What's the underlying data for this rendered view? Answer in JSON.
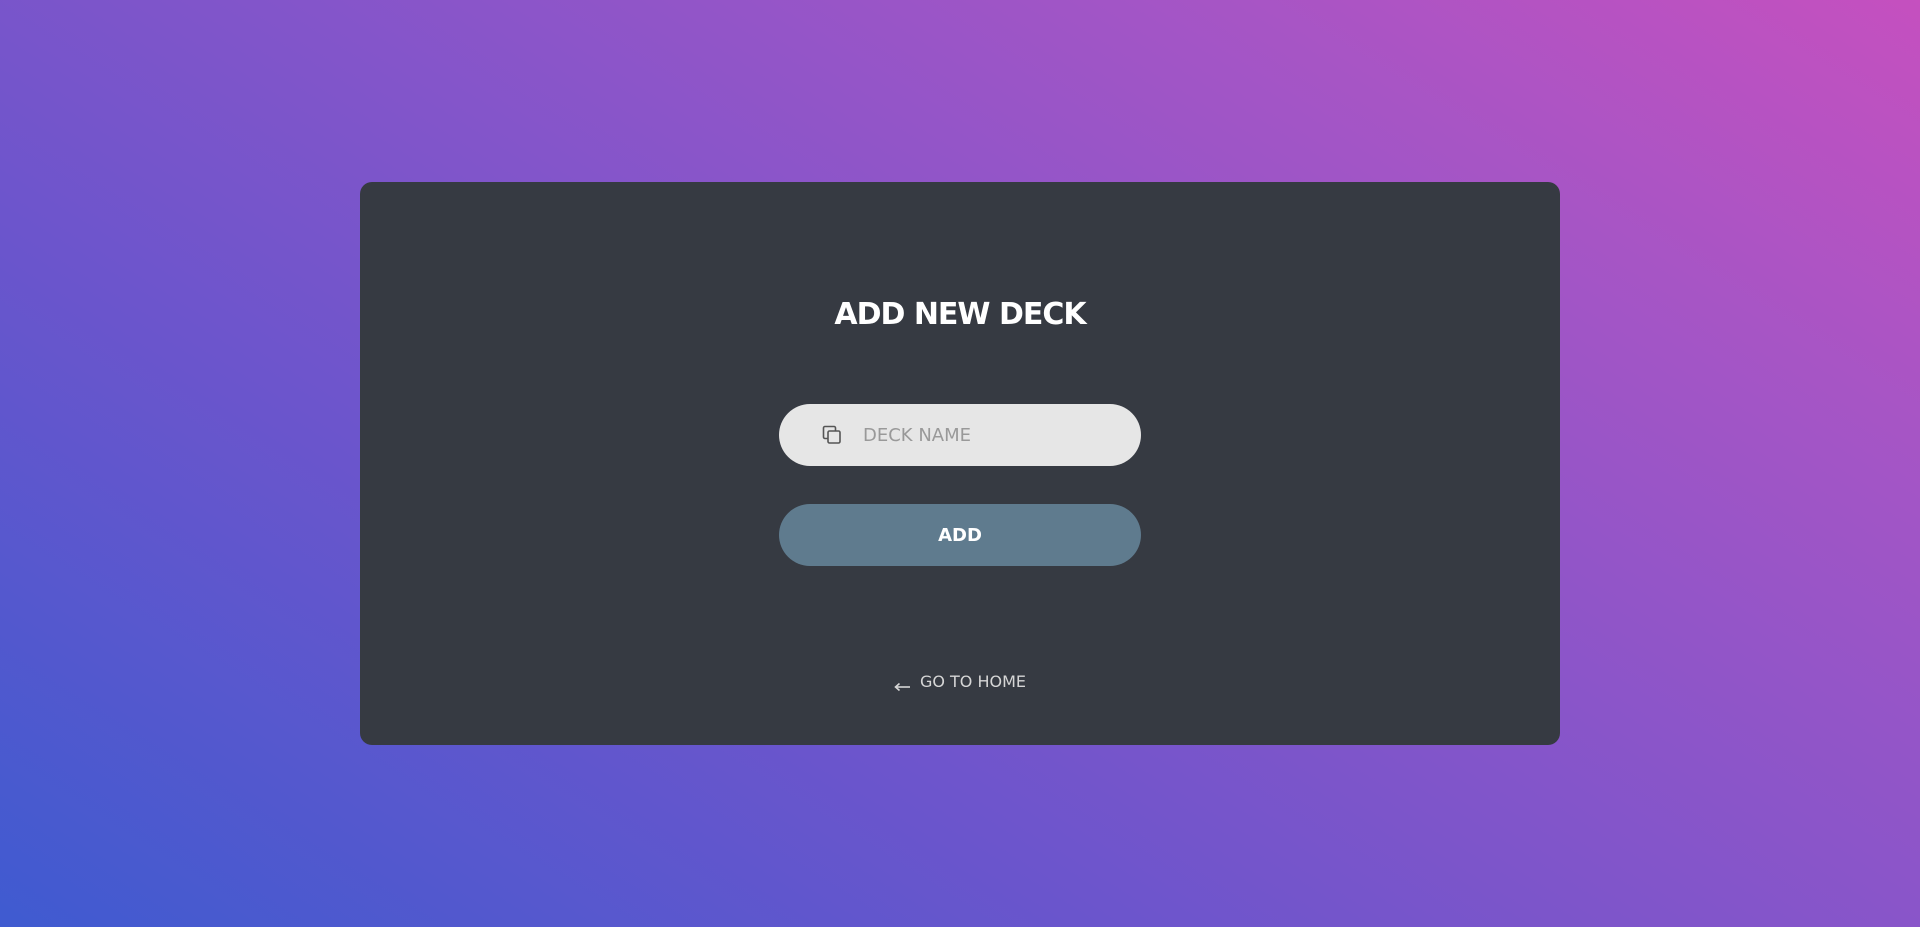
{
  "form": {
    "title": "ADD NEW DECK",
    "deck_name_placeholder": "DECK NAME",
    "deck_name_value": "",
    "deck_name_icon": "copy-icon",
    "add_label": "ADD"
  },
  "footer": {
    "home_label": "GO TO HOME",
    "home_icon": "arrow-left-icon"
  },
  "colors": {
    "card_background": "#363a42",
    "input_background": "#e6e6e6",
    "button_background": "#5f7b8e",
    "gradient_start": "#3f5bd0",
    "gradient_end": "#c550bf"
  }
}
